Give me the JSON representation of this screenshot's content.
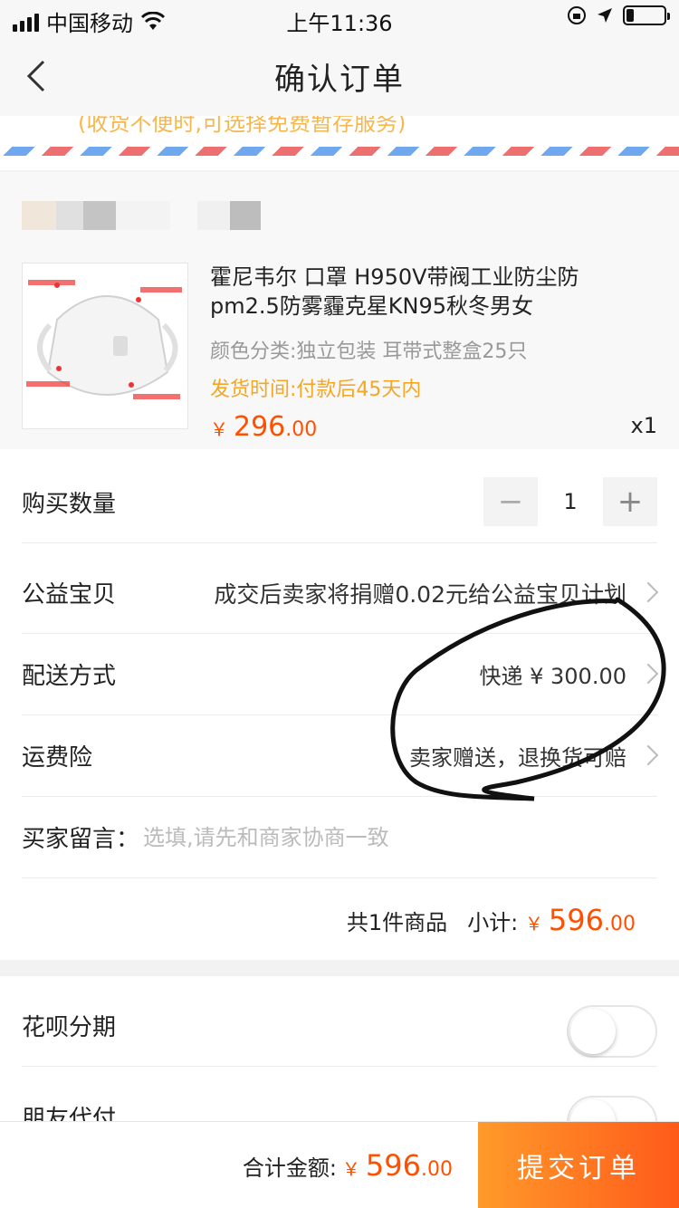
{
  "status_bar": {
    "carrier": "中国移动",
    "time": "上午11:36"
  },
  "nav": {
    "title": "确认订单"
  },
  "address": {
    "tip": "(收货不便时,可选择免费暂存服务)"
  },
  "product": {
    "title": "霍尼韦尔 口罩 H950V带阀工业防尘防pm2.5防雾霾克星KN95秋冬男女",
    "spec": "颜色分类:独立包装 耳带式整盒25只",
    "ship_time": "发货时间:付款后45天内",
    "price_symbol": "￥",
    "price_int": "296",
    "price_dec": ".00",
    "qty": "x1"
  },
  "order": {
    "quantity_label": "购买数量",
    "quantity_value": "1",
    "minus": "−",
    "plus": "+",
    "charity_label": "公益宝贝",
    "charity_value": "成交后卖家将捐赠0.02元给公益宝贝计划",
    "delivery_label": "配送方式",
    "delivery_value": "快递 ¥ 300.00",
    "insurance_label": "运费险",
    "insurance_value": "卖家赠送，退换货可赔",
    "message_label": "买家留言：",
    "message_placeholder": "选填,请先和商家协商一致",
    "count_text": "共1件商品",
    "subtotal_label": "小计:",
    "subtotal_symbol": "￥",
    "subtotal_int": "596",
    "subtotal_dec": ".00"
  },
  "payment": {
    "huabei_label": "花呗分期",
    "friend_pay_label": "朋友代付"
  },
  "footer": {
    "total_label": "合计金额:",
    "total_symbol": "￥",
    "total_int": "596",
    "total_dec": ".00",
    "submit_label": "提交订单"
  },
  "colors": {
    "accent": "#ff5000",
    "warning": "#f5a623",
    "submit_start": "#ff9a2a",
    "submit_end": "#ff5a1a"
  },
  "icons": [
    "wifi-icon",
    "lock-rotation-icon",
    "location-arrow-icon",
    "battery-icon",
    "back-icon",
    "chevron-right-icon"
  ]
}
